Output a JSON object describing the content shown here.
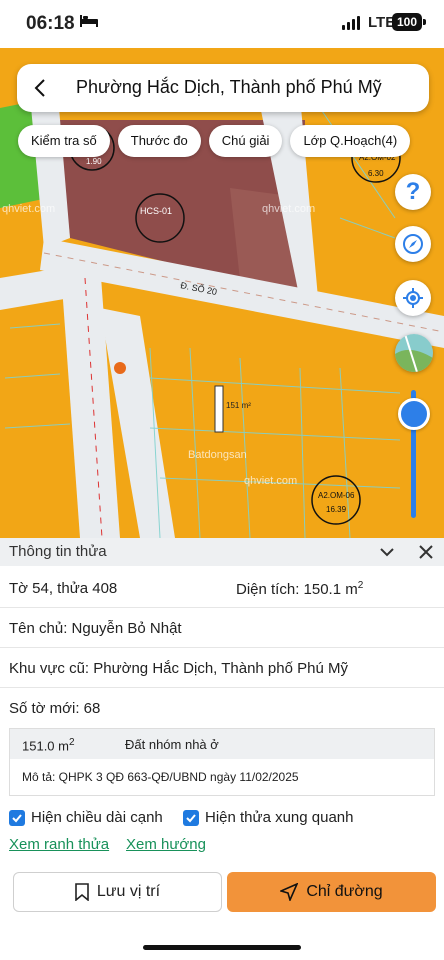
{
  "status_bar": {
    "time": "06:18",
    "network": "LTE",
    "battery": "100"
  },
  "search": {
    "title": "Phường Hắc Dịch, Thành phố Phú Mỹ"
  },
  "chips": [
    {
      "label": "Kiểm tra số"
    },
    {
      "label": "Thước đo"
    },
    {
      "label": "Chú giải"
    },
    {
      "label": "Lớp Q.Hoạch(4)"
    }
  ],
  "map": {
    "road_label": "Đ. SỐ 20",
    "zone_labels": [
      "HCS-01",
      "A2.OM-02",
      "A2.OM-06",
      "1.90",
      "6.30",
      "16.39"
    ],
    "parcel_area": "151 m²",
    "watermarks": [
      "qhviet.com",
      "qhviet.com",
      "qhviet.com",
      "Batdongsan"
    ],
    "colors": {
      "residential": "#f2a616",
      "commercial": "#8f4d4b",
      "green": "#5cbf3a",
      "road": "#e9ecef"
    }
  },
  "panel": {
    "header": "Thông tin thửa",
    "sheet_parcel": "Tờ 54, thửa 408",
    "area_label": "Diện tích: 150.1 m",
    "area_sup": "2",
    "owner": "Tên chủ: Nguyễn Bỏ Nhật",
    "old_area": "Khu vực cũ: Phường Hắc Dịch, Thành phố Phú Mỹ",
    "new_sheet": "Số tờ mới: 68",
    "detail_area": "151.0 m",
    "detail_area_sup": "2",
    "land_type": "Đất nhóm nhà ở",
    "description": "Mô tả: QHPK 3 QĐ 663-QĐ/UBND ngày 11/02/2025",
    "check_edge_length": "Hiện chiều dài cạnh",
    "check_neighbors": "Hiện thửa xung quanh",
    "link_boundary": "Xem ranh thửa",
    "link_direction": "Xem hướng",
    "save_button": "Lưu vị trí",
    "route_button": "Chỉ đường"
  },
  "colors": {
    "accent": "#2d7fe8",
    "route": "#f2933a",
    "link": "#18915a"
  }
}
